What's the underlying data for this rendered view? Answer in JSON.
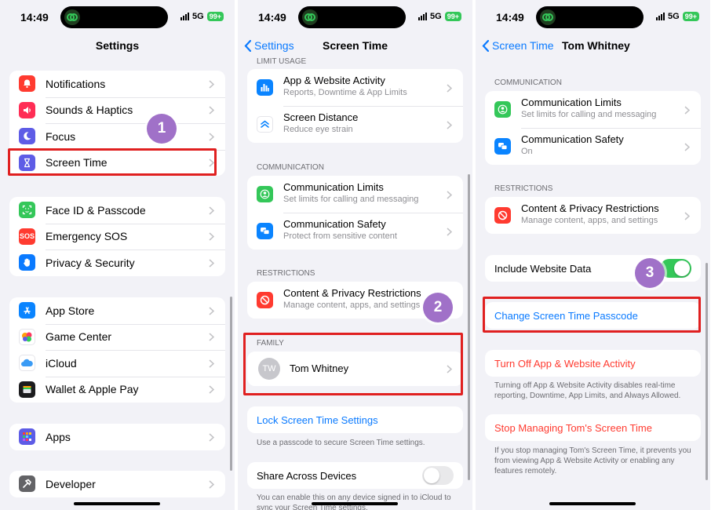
{
  "status": {
    "time": "14:49",
    "network": "5G",
    "battery": "99+"
  },
  "panel1": {
    "title": "Settings",
    "group1": [
      {
        "label": "Notifications",
        "icon": "bell-icon",
        "color": "#ff3b30"
      },
      {
        "label": "Sounds & Haptics",
        "icon": "speaker-icon",
        "color": "#ff2d55"
      },
      {
        "label": "Focus",
        "icon": "moon-icon",
        "color": "#5e5ce6"
      },
      {
        "label": "Screen Time",
        "icon": "hourglass-icon",
        "color": "#5e5ce6"
      }
    ],
    "group2": [
      {
        "label": "Face ID & Passcode",
        "icon": "faceid-icon",
        "color": "#34c759"
      },
      {
        "label": "Emergency SOS",
        "icon": "sos-icon",
        "color": "#ff3b30",
        "glyph": "SOS"
      },
      {
        "label": "Privacy & Security",
        "icon": "hand-icon",
        "color": "#0a7aff"
      }
    ],
    "group3": [
      {
        "label": "App Store",
        "icon": "appstore-icon",
        "color": "#0a84ff"
      },
      {
        "label": "Game Center",
        "icon": "gamecenter-icon",
        "color": "#ffffff"
      },
      {
        "label": "iCloud",
        "icon": "cloud-icon",
        "color": "#ffffff"
      },
      {
        "label": "Wallet & Apple Pay",
        "icon": "wallet-icon",
        "color": "#1c1c1e"
      }
    ],
    "group4": [
      {
        "label": "Apps",
        "icon": "apps-grid-icon",
        "color": "#5e5ce6"
      }
    ],
    "group5": [
      {
        "label": "Developer",
        "icon": "hammer-icon",
        "color": "#636366"
      }
    ],
    "step": "1"
  },
  "panel2": {
    "back": "Settings",
    "title": "Screen Time",
    "sec_limit": "LIMIT USAGE",
    "limit": [
      {
        "title": "App & Website Activity",
        "sub": "Reports, Downtime & App Limits",
        "icon": "bar-chart-icon",
        "color": "#0a84ff"
      },
      {
        "title": "Screen Distance",
        "sub": "Reduce eye strain",
        "icon": "chevrons-up-icon",
        "color": "#ffffff"
      }
    ],
    "sec_comm": "COMMUNICATION",
    "comm": [
      {
        "title": "Communication Limits",
        "sub": "Set limits for calling and messaging",
        "icon": "person-circle-icon",
        "color": "#34c759"
      },
      {
        "title": "Communication Safety",
        "sub": "Protect from sensitive content",
        "icon": "chat-bubbles-icon",
        "color": "#0a84ff"
      }
    ],
    "sec_restr": "RESTRICTIONS",
    "restr": {
      "title": "Content & Privacy Restrictions",
      "sub": "Manage content, apps, and settings",
      "icon": "no-entry-icon",
      "color": "#ff3b30"
    },
    "sec_family": "FAMILY",
    "member": {
      "initials": "TW",
      "name": "Tom Whitney"
    },
    "lock_label": "Lock Screen Time Settings",
    "lock_note": "Use a passcode to secure Screen Time settings.",
    "share_label": "Share Across Devices",
    "share_note": "You can enable this on any device signed in to iCloud to sync your Screen Time settings.",
    "step": "2"
  },
  "panel3": {
    "back": "Screen Time",
    "title": "Tom Whitney",
    "sec_comm": "COMMUNICATION",
    "comm": [
      {
        "title": "Communication Limits",
        "sub": "Set limits for calling and messaging",
        "icon": "person-circle-icon",
        "color": "#34c759"
      },
      {
        "title": "Communication Safety",
        "sub": "On",
        "icon": "chat-bubbles-icon",
        "color": "#0a84ff"
      }
    ],
    "sec_restr": "RESTRICTIONS",
    "restr": {
      "title": "Content & Privacy Restrictions",
      "sub": "Manage content, apps, and settings",
      "icon": "no-entry-icon",
      "color": "#ff3b30"
    },
    "include_label": "Include Website Data",
    "include_on": true,
    "change_label": "Change Screen Time Passcode",
    "turnoff_label": "Turn Off App & Website Activity",
    "turnoff_note": "Turning off App & Website Activity disables real-time reporting, Downtime, App Limits, and Always Allowed.",
    "stop_label": "Stop Managing Tom's Screen Time",
    "stop_note": "If you stop managing Tom's Screen Time, it prevents you from viewing App & Website Activity or enabling any features remotely.",
    "step": "3"
  },
  "colors": {
    "accent": "#0a7aff",
    "highlight": "#e02020",
    "badge": "#a071c8",
    "toggle_on": "#34c759"
  }
}
